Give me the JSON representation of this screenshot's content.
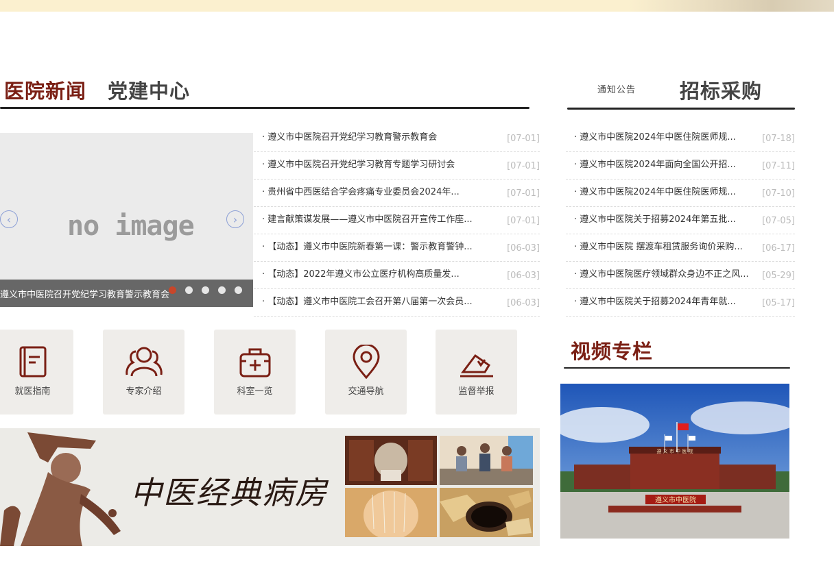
{
  "header_strip": {},
  "news_section": {
    "tab_active": "医院新闻",
    "tab_inactive": "党建中心"
  },
  "slider": {
    "placeholder": "no image",
    "caption": "遵义市中医院召开党纪学习教育警示教育会",
    "prev_arrow": "‹",
    "next_arrow": "›",
    "dot_count": 5,
    "active_dot": 1
  },
  "news_items": [
    {
      "title": "遵义市中医院召开党纪学习教育警示教育会",
      "date": "[07-01]"
    },
    {
      "title": "遵义市中医院召开党纪学习教育专题学习研讨会",
      "date": "[07-01]"
    },
    {
      "title": "贵州省中西医结合学会疼痛专业委员会2024年...",
      "date": "[07-01]"
    },
    {
      "title": "建言献策谋发展——遵义市中医院召开宣传工作座...",
      "date": "[07-01]"
    },
    {
      "title": "【动态】遵义市中医院新春第一课：警示教育警钟...",
      "date": "[06-03]"
    },
    {
      "title": "【动态】2022年遵义市公立医疗机构高质量发...",
      "date": "[06-03]"
    },
    {
      "title": "【动态】遵义市中医院工会召开第八届第一次会员...",
      "date": "[06-03]"
    }
  ],
  "notice_section": {
    "tab_inactive": "通知公告",
    "tab_active": "招标采购"
  },
  "notice_items": [
    {
      "title": "遵义市中医院2024年中医住院医师规...",
      "date": "[07-18]"
    },
    {
      "title": "遵义市中医院2024年面向全国公开招...",
      "date": "[07-11]"
    },
    {
      "title": "遵义市中医院2024年中医住院医师规...",
      "date": "[07-10]"
    },
    {
      "title": "遵义市中医院关于招募2024年第五批...",
      "date": "[07-05]"
    },
    {
      "title": "遵义市中医院 摆渡车租赁服务询价采购...",
      "date": "[06-17]"
    },
    {
      "title": "遵义市中医院医疗领域群众身边不正之风...",
      "date": "[05-29]"
    },
    {
      "title": "遵义市中医院关于招募2024年青年就...",
      "date": "[05-17]"
    }
  ],
  "services": [
    {
      "label": "就医指南",
      "icon": "book-icon"
    },
    {
      "label": "专家介绍",
      "icon": "doctors-icon"
    },
    {
      "label": "科室一览",
      "icon": "medkit-icon"
    },
    {
      "label": "交通导航",
      "icon": "location-pin-icon"
    },
    {
      "label": "监督举报",
      "icon": "report-icon"
    }
  ],
  "banner": {
    "text": "中医经典病房"
  },
  "video_section": {
    "title": "视频专栏",
    "building_sign": "遵义市中医院",
    "roof_sign": "遵 义 市 中 医 院"
  },
  "colors": {
    "accent": "#7a1f14",
    "icon": "#7a1f14",
    "tile_bg": "#efedea",
    "date": "#bbbbbb"
  }
}
